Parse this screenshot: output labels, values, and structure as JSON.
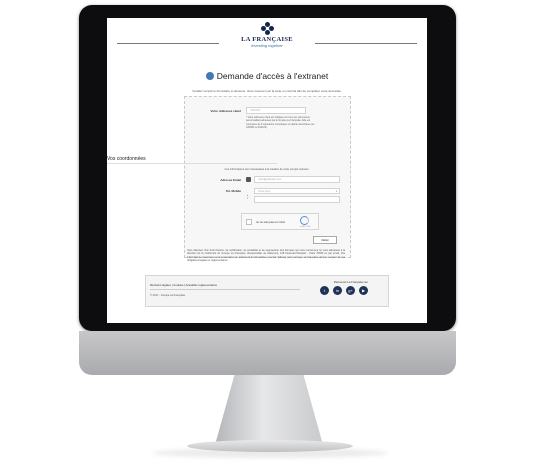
{
  "brand": {
    "name": "LA FRANÇAISE",
    "tagline": "Investing together"
  },
  "page": {
    "title": "Demande d'accès à l'extranet",
    "intro": "Veuillez remplir le formulaire ci-dessous. Vous recevrez par la suite un courriel afin de compléter votre demande."
  },
  "form": {
    "client_ref_label": "Votre référence client",
    "client_ref_placeholder": "XXXXXX",
    "client_ref_hint": "* Votre référence client est indiquée sur tous vos documents personnalisés adressés par le Groupe La Française. Elle est composée de 6 caractères numériques ou alpha-numériques (ex : 100000 ou A10123).",
    "section_title": "Vos coordonnées",
    "section_desc": "Ces informations sont nécessaires à la création de votre compte extranet",
    "email_label": "Adresse Email",
    "email_placeholder": "votre@adresse.com",
    "mobile_label": "Tel. Mobile",
    "mobile_country_placeholder": "Votre pays",
    "captcha_label": "Je ne suis pas un robot",
    "captcha_brand": "reCAPTCHA",
    "submit_label": "Valider"
  },
  "legal": "Vous disposez d'un droit d'accès, de rectification, de portabilité et de suppression des données qui vous concernent ou vous adressant à la direction de la conformité du Groupe La Française. Responsable de traitement, 128 boulevard Raspail – Paris 75006 ou par email. Vos informations concernées sont nécessaires au traitement du formulaire et seront utilisées par le Groupe La Française dans le respect de ses obligations légales et réglementaires.",
  "footer": {
    "links": "Mentions légales | Cookies | Actualités réglementaires",
    "copyright": "© 2017 - Groupe La Française",
    "follow_label": "Retrouvez La Française sur",
    "socials": [
      {
        "icon": "twitter-icon",
        "glyph": "t"
      },
      {
        "icon": "linkedin-icon",
        "glyph": "in"
      },
      {
        "icon": "google-plus-icon",
        "glyph": "g+"
      },
      {
        "icon": "youtube-icon",
        "glyph": "▶"
      }
    ]
  },
  "colors": {
    "brand_navy": "#10264d",
    "accent_blue": "#4576b5",
    "bezel": "#0d0d0f"
  }
}
